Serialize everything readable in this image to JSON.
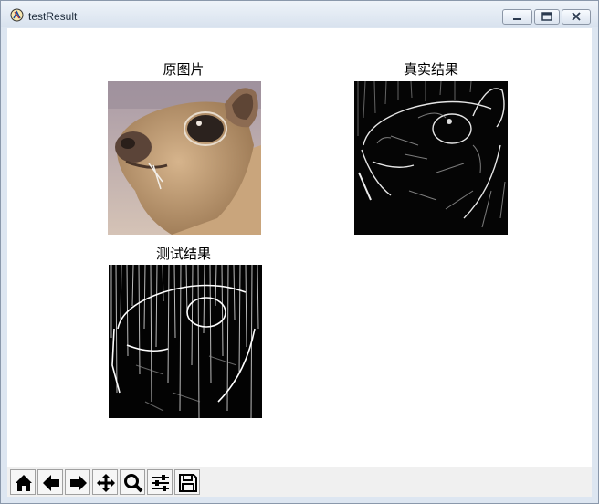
{
  "window": {
    "title": "testResult",
    "controls": [
      "minimize-icon",
      "restore-icon",
      "close-icon"
    ]
  },
  "figure": {
    "panels": [
      {
        "title": "原图片",
        "content": "photo of a small rodent face"
      },
      {
        "title": "真实结果",
        "content": "edge map on black"
      },
      {
        "title": "测试结果",
        "content": "noisy edge map on black"
      }
    ]
  },
  "toolbar": {
    "buttons": [
      "home-icon",
      "back-arrow-icon",
      "forward-arrow-icon",
      "pan-icon",
      "zoom-icon",
      "configure-subplots-icon",
      "save-icon"
    ]
  },
  "colors": {
    "accent": "#d8e2ee",
    "client_bg": "#ffffff",
    "toolbar_bg": "#f0f0f0"
  }
}
